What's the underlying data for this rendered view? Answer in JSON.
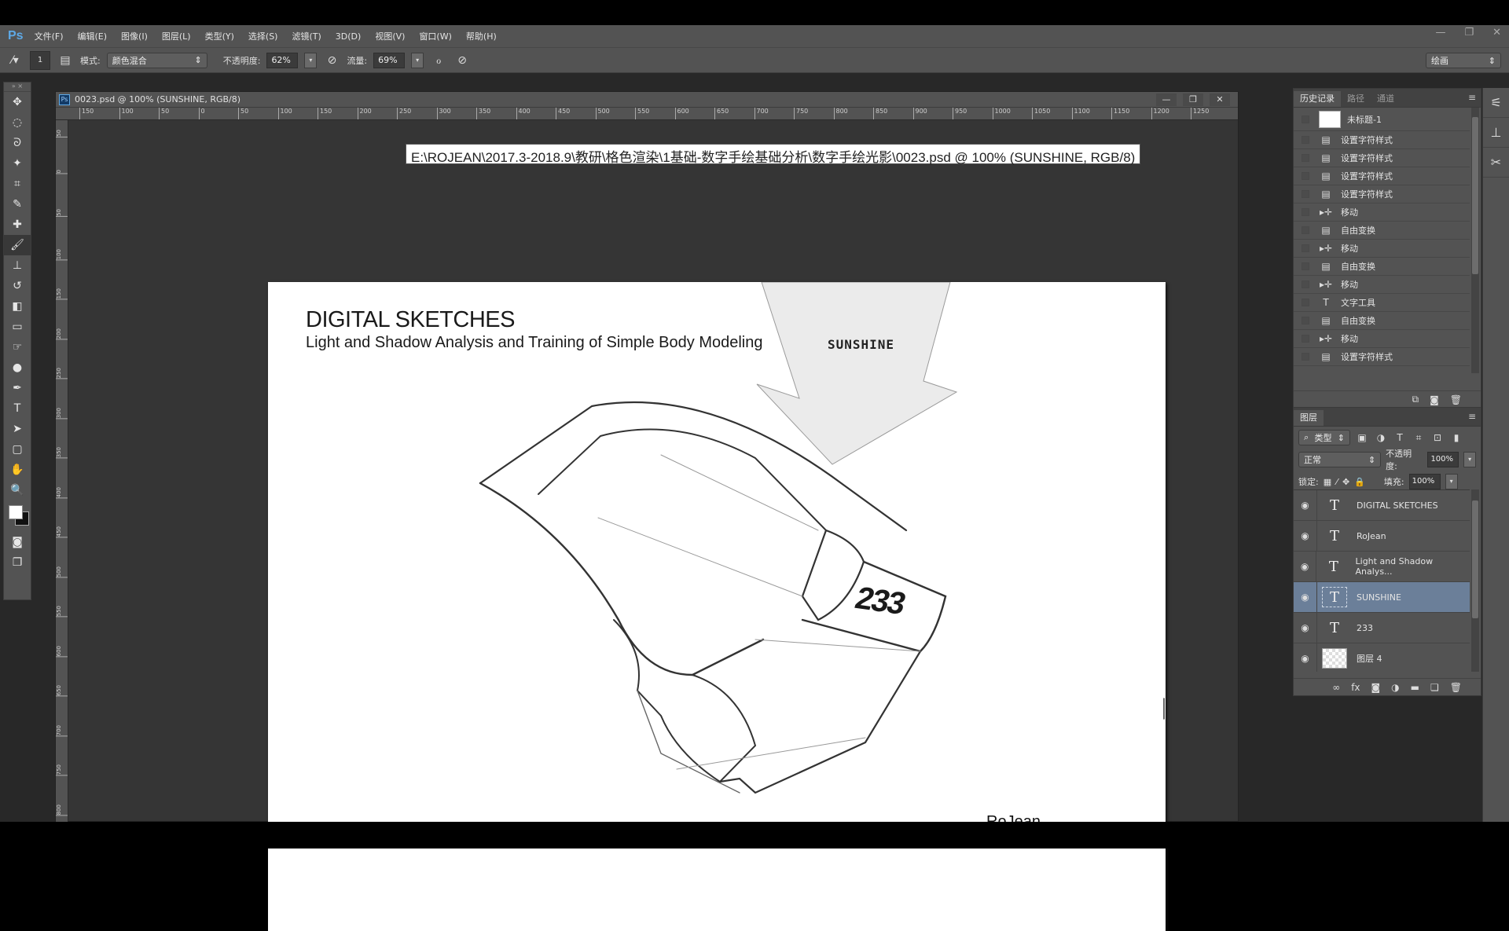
{
  "app": {
    "logo": "Ps"
  },
  "menu": [
    "文件(F)",
    "编辑(E)",
    "图像(I)",
    "图层(L)",
    "类型(Y)",
    "选择(S)",
    "滤镜(T)",
    "3D(D)",
    "视图(V)",
    "窗口(W)",
    "帮助(H)"
  ],
  "window_controls": {
    "minimize": "—",
    "restore": "❐",
    "close": "✕"
  },
  "options": {
    "brush_size": "1",
    "mode_label": "模式:",
    "mode_value": "颜色混合",
    "opacity_label": "不透明度:",
    "opacity_value": "62%",
    "flow_label": "流量:",
    "flow_value": "69%",
    "workspace": "绘画"
  },
  "tools": [
    {
      "name": "move-tool",
      "glyph": "✥"
    },
    {
      "name": "marquee-tool",
      "glyph": "◌"
    },
    {
      "name": "lasso-tool",
      "glyph": "ᘐ"
    },
    {
      "name": "quick-select-tool",
      "glyph": "✦"
    },
    {
      "name": "crop-tool",
      "glyph": "⌗"
    },
    {
      "name": "eyedropper-tool",
      "glyph": "✎"
    },
    {
      "name": "healing-tool",
      "glyph": "✚"
    },
    {
      "name": "brush-tool",
      "glyph": "🖌",
      "active": true
    },
    {
      "name": "stamp-tool",
      "glyph": "⊥"
    },
    {
      "name": "history-brush-tool",
      "glyph": "↺"
    },
    {
      "name": "eraser-tool",
      "glyph": "◧"
    },
    {
      "name": "gradient-tool",
      "glyph": "▭"
    },
    {
      "name": "smudge-tool",
      "glyph": "☞"
    },
    {
      "name": "dodge-tool",
      "glyph": "●"
    },
    {
      "name": "pen-tool",
      "glyph": "✒"
    },
    {
      "name": "type-tool",
      "glyph": "T"
    },
    {
      "name": "path-select-tool",
      "glyph": "➤"
    },
    {
      "name": "shape-tool",
      "glyph": "▢"
    },
    {
      "name": "hand-tool",
      "glyph": "✋"
    },
    {
      "name": "zoom-tool",
      "glyph": "🔍"
    }
  ],
  "document": {
    "tab_title": "0023.psd @ 100% (SUNSHINE, RGB/8)",
    "tooltip": "E:\\ROJEAN\\2017.3-2018.9\\教研\\格色渲染\\1基础-数字手绘基础分析\\数字手绘光影\\0023.psd @ 100% (SUNSHINE, RGB/8)",
    "ruler_h": [
      "150",
      "100",
      "50",
      "0",
      "50",
      "100",
      "150",
      "200",
      "250",
      "300",
      "350",
      "400",
      "450",
      "500",
      "550",
      "600",
      "650",
      "700",
      "750",
      "800",
      "850",
      "900",
      "950",
      "1000",
      "1050",
      "1100",
      "1150",
      "1200",
      "1250"
    ],
    "ruler_v": [
      "50",
      "0",
      "50",
      "100",
      "150",
      "200",
      "250",
      "300",
      "350",
      "400",
      "450",
      "500",
      "550",
      "600",
      "650",
      "700",
      "750",
      "800"
    ]
  },
  "canvas": {
    "title": "DIGITAL SKETCHES",
    "subtitle": "Light and Shadow Analysis and Training of Simple Body Modeling",
    "tag": "SUNSHINE",
    "number": "233",
    "author": "RoJean"
  },
  "history": {
    "tabs": [
      "历史记录",
      "路径",
      "通道"
    ],
    "snapshot": "未标题-1",
    "items": [
      {
        "icon": "doc",
        "label": "设置字符样式"
      },
      {
        "icon": "doc",
        "label": "设置字符样式"
      },
      {
        "icon": "doc",
        "label": "设置字符样式"
      },
      {
        "icon": "doc",
        "label": "设置字符样式"
      },
      {
        "icon": "move",
        "label": "移动"
      },
      {
        "icon": "doc",
        "label": "自由变换"
      },
      {
        "icon": "move",
        "label": "移动"
      },
      {
        "icon": "doc",
        "label": "自由变换"
      },
      {
        "icon": "move",
        "label": "移动"
      },
      {
        "icon": "type",
        "label": "文字工具"
      },
      {
        "icon": "doc",
        "label": "自由变换"
      },
      {
        "icon": "move",
        "label": "移动"
      },
      {
        "icon": "doc",
        "label": "设置字符样式"
      }
    ]
  },
  "layers": {
    "tab": "图层",
    "filter_kind": "类型",
    "blend_mode": "正常",
    "opacity_label": "不透明度:",
    "opacity_value": "100%",
    "lock_label": "锁定:",
    "fill_label": "填充:",
    "fill_value": "100%",
    "items": [
      {
        "type": "text",
        "name": "DIGITAL SKETCHES",
        "selected": false
      },
      {
        "type": "text",
        "name": "RoJean",
        "selected": false
      },
      {
        "type": "text",
        "name": "Light and Shadow Analys...",
        "selected": false
      },
      {
        "type": "text",
        "name": "SUNSHINE",
        "selected": true
      },
      {
        "type": "text",
        "name": "233",
        "selected": false
      },
      {
        "type": "pixel",
        "name": "图层 4",
        "selected": false
      }
    ]
  }
}
